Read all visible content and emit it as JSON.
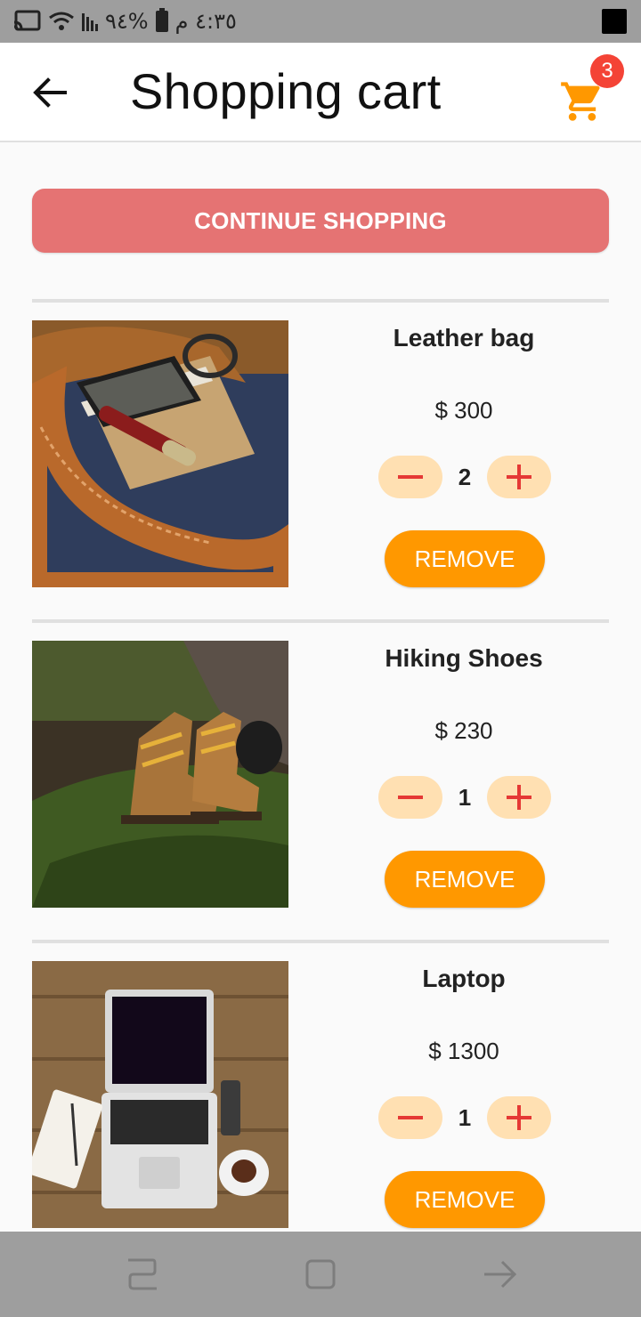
{
  "status_bar": {
    "time": "٤:٣٥ م",
    "battery": "%٩٤"
  },
  "app_bar": {
    "title": "Shopping cart",
    "cart_count": "3"
  },
  "continue_label": "CONTINUE SHOPPING",
  "cart_items": [
    {
      "name": "Leather bag",
      "price": "$ 300",
      "quantity": "2",
      "remove_label": "REMOVE"
    },
    {
      "name": "Hiking Shoes",
      "price": "$ 230",
      "quantity": "1",
      "remove_label": "REMOVE"
    },
    {
      "name": "Laptop",
      "price": "$ 1300",
      "quantity": "1",
      "remove_label": "REMOVE"
    }
  ],
  "colors": {
    "accent": "#ff9800",
    "continue_button": "#e57373",
    "quantity_button": "#ffe0b2",
    "quantity_icon": "#e53935",
    "badge": "#f44336"
  },
  "icons": {
    "back": "arrow-back-icon",
    "cart": "shopping-cart-icon",
    "minus": "minus-icon",
    "plus": "plus-icon"
  }
}
